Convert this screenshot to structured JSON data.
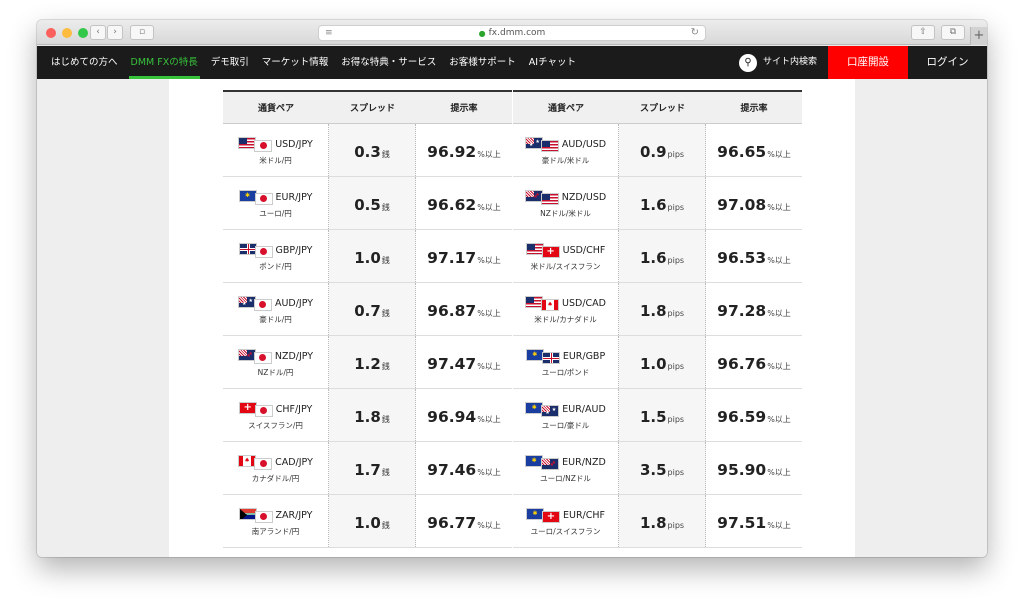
{
  "browser": {
    "url": "fx.dmm.com",
    "colors": {
      "close": "#fc605c",
      "minimize": "#fdbc40",
      "zoom": "#34c84a"
    },
    "icons": [
      "back-icon",
      "forward-icon",
      "sidebar-icon",
      "reader-icon",
      "reload-icon",
      "share-icon",
      "tabs-icon",
      "new-tab-icon"
    ]
  },
  "nav": {
    "items": [
      {
        "label": "はじめての方へ",
        "active": false
      },
      {
        "label": "DMM FXの特長",
        "active": true
      },
      {
        "label": "デモ取引",
        "active": false
      },
      {
        "label": "マーケット情報",
        "active": false
      },
      {
        "label": "お得な特典・サービス",
        "active": false
      },
      {
        "label": "お客様サポート",
        "active": false
      },
      {
        "label": "AIチャット",
        "active": false
      }
    ],
    "search_label": "サイト内検索",
    "open_account_label": "口座開設",
    "login_label": "ログイン",
    "colors": {
      "bg": "#1b1b1b",
      "active": "#37c23b",
      "cta": "#ff0000"
    }
  },
  "table": {
    "headers": {
      "pair": "通貨ペア",
      "spread": "スプレッド",
      "rate": "提示率"
    },
    "left": [
      {
        "code": "USD/JPY",
        "sub": "米ドル/円",
        "flags": [
          "us",
          "jp"
        ],
        "spread": "0.3",
        "unit": "銭",
        "rate": "96.92",
        "suffix": "%以上"
      },
      {
        "code": "EUR/JPY",
        "sub": "ユーロ/円",
        "flags": [
          "eu",
          "jp"
        ],
        "spread": "0.5",
        "unit": "銭",
        "rate": "96.62",
        "suffix": "%以上"
      },
      {
        "code": "GBP/JPY",
        "sub": "ポンド/円",
        "flags": [
          "gb",
          "jp"
        ],
        "spread": "1.0",
        "unit": "銭",
        "rate": "97.17",
        "suffix": "%以上"
      },
      {
        "code": "AUD/JPY",
        "sub": "豪ドル/円",
        "flags": [
          "au",
          "jp"
        ],
        "spread": "0.7",
        "unit": "銭",
        "rate": "96.87",
        "suffix": "%以上"
      },
      {
        "code": "NZD/JPY",
        "sub": "NZドル/円",
        "flags": [
          "nz",
          "jp"
        ],
        "spread": "1.2",
        "unit": "銭",
        "rate": "97.47",
        "suffix": "%以上"
      },
      {
        "code": "CHF/JPY",
        "sub": "スイスフラン/円",
        "flags": [
          "ch",
          "jp"
        ],
        "spread": "1.8",
        "unit": "銭",
        "rate": "96.94",
        "suffix": "%以上"
      },
      {
        "code": "CAD/JPY",
        "sub": "カナダドル/円",
        "flags": [
          "ca",
          "jp"
        ],
        "spread": "1.7",
        "unit": "銭",
        "rate": "97.46",
        "suffix": "%以上"
      },
      {
        "code": "ZAR/JPY",
        "sub": "南アランド/円",
        "flags": [
          "za",
          "jp"
        ],
        "spread": "1.0",
        "unit": "銭",
        "rate": "96.77",
        "suffix": "%以上"
      }
    ],
    "right": [
      {
        "code": "AUD/USD",
        "sub": "豪ドル/米ドル",
        "flags": [
          "au",
          "us"
        ],
        "spread": "0.9",
        "unit": "pips",
        "rate": "96.65",
        "suffix": "%以上"
      },
      {
        "code": "NZD/USD",
        "sub": "NZドル/米ドル",
        "flags": [
          "nz",
          "us"
        ],
        "spread": "1.6",
        "unit": "pips",
        "rate": "97.08",
        "suffix": "%以上"
      },
      {
        "code": "USD/CHF",
        "sub": "米ドル/スイスフラン",
        "flags": [
          "us",
          "ch"
        ],
        "spread": "1.6",
        "unit": "pips",
        "rate": "96.53",
        "suffix": "%以上"
      },
      {
        "code": "USD/CAD",
        "sub": "米ドル/カナダドル",
        "flags": [
          "us",
          "ca"
        ],
        "spread": "1.8",
        "unit": "pips",
        "rate": "97.28",
        "suffix": "%以上"
      },
      {
        "code": "EUR/GBP",
        "sub": "ユーロ/ポンド",
        "flags": [
          "eu",
          "gb"
        ],
        "spread": "1.0",
        "unit": "pips",
        "rate": "96.76",
        "suffix": "%以上"
      },
      {
        "code": "EUR/AUD",
        "sub": "ユーロ/豪ドル",
        "flags": [
          "eu",
          "au"
        ],
        "spread": "1.5",
        "unit": "pips",
        "rate": "96.59",
        "suffix": "%以上"
      },
      {
        "code": "EUR/NZD",
        "sub": "ユーロ/NZドル",
        "flags": [
          "eu",
          "nz"
        ],
        "spread": "3.5",
        "unit": "pips",
        "rate": "95.90",
        "suffix": "%以上"
      },
      {
        "code": "EUR/CHF",
        "sub": "ユーロ/スイスフラン",
        "flags": [
          "eu",
          "ch"
        ],
        "spread": "1.8",
        "unit": "pips",
        "rate": "97.51",
        "suffix": "%以上"
      }
    ]
  }
}
